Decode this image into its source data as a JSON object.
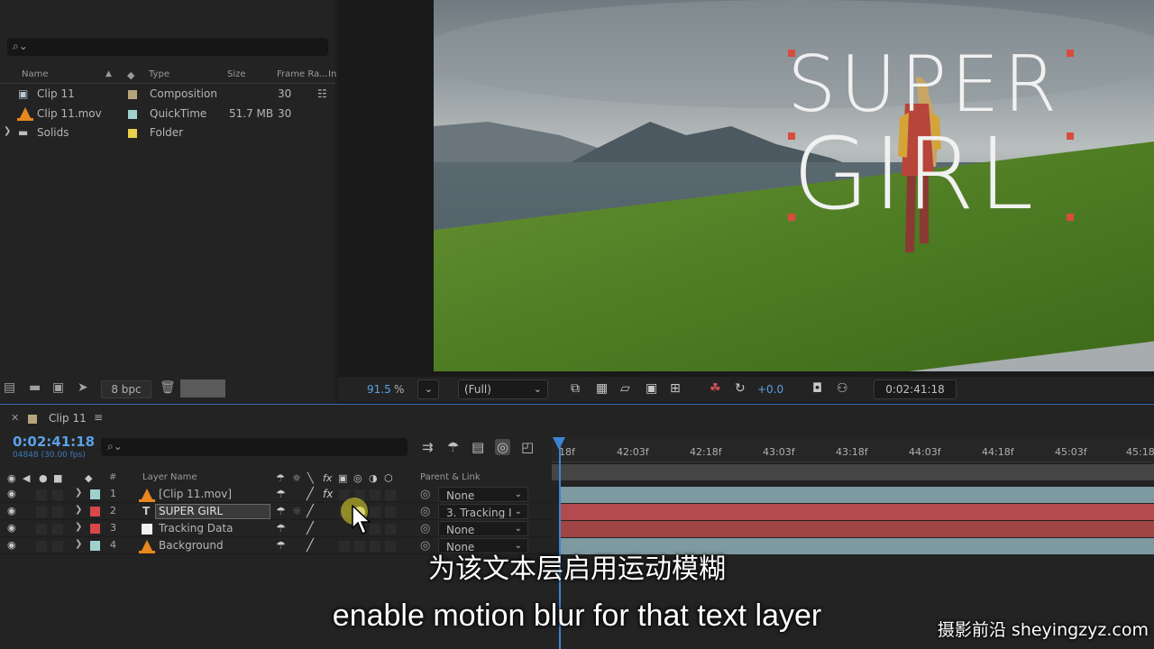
{
  "project": {
    "columns": [
      "Name",
      "Type",
      "Size",
      "Frame Ra...",
      "In"
    ],
    "items": [
      {
        "name": "Clip 11",
        "type": "Composition",
        "size": "",
        "fps": "30",
        "color": "#b7a47b"
      },
      {
        "name": "Clip 11.mov",
        "type": "QuickTime",
        "size": "51.7 MB",
        "fps": "30",
        "color": "#9fd1cf"
      },
      {
        "name": "Solids",
        "type": "Folder",
        "size": "",
        "fps": "",
        "color": "#e8d04a"
      }
    ],
    "bpc": "8 bpc"
  },
  "viewer": {
    "overlay_line1": "SUPER",
    "overlay_line2": "GIRL",
    "zoom": "91.5",
    "zoom_unit": "%",
    "resolution": "(Full)",
    "exposure": "+0.0",
    "timecode": "0:02:41:18"
  },
  "timeline": {
    "comp_name": "Clip 11",
    "current_time": "0:02:41:18",
    "current_frames": "04848 (30.00 fps)",
    "ruler_ticks": [
      "18f",
      "42:03f",
      "42:18f",
      "43:03f",
      "43:18f",
      "44:03f",
      "44:18f",
      "45:03f",
      "45:18"
    ],
    "col_hash": "#",
    "col_layer_name": "Layer Name",
    "col_parent": "Parent & Link",
    "layers": [
      {
        "num": "1",
        "name": "[Clip 11.mov]",
        "parent": "None",
        "color": "#9fd1cf",
        "bar": "#7d9aa0"
      },
      {
        "num": "2",
        "name": "SUPER GIRL",
        "parent": "3. Tracking I",
        "color": "#d8484a",
        "bar": "#b34a4d"
      },
      {
        "num": "3",
        "name": "Tracking Data",
        "parent": "None",
        "color": "#eeeeee",
        "bar": "#a04446"
      },
      {
        "num": "4",
        "name": "Background",
        "parent": "None",
        "color": "#9fd1cf",
        "bar": "#7d9aa0"
      }
    ]
  },
  "subtitles": {
    "chinese": "为该文本层启用运动模糊",
    "english": "enable motion blur for that text layer"
  },
  "watermark": "摄影前沿 sheyingzyz.com"
}
